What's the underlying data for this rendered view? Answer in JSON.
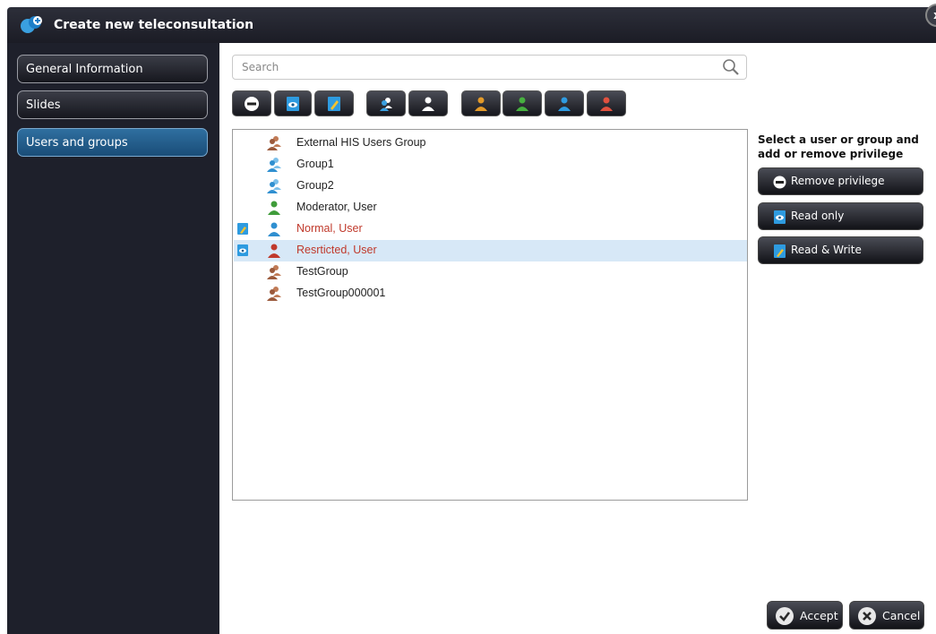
{
  "window": {
    "title": "Create new teleconsultation",
    "close_label": "x"
  },
  "sidebar": {
    "items": [
      {
        "label": "General Information",
        "active": false
      },
      {
        "label": "Slides",
        "active": false
      },
      {
        "label": "Users and groups",
        "active": true
      }
    ]
  },
  "search": {
    "placeholder": "Search",
    "value": ""
  },
  "toolbar": {
    "buttons": [
      {
        "icon": "remove-privilege-icon"
      },
      {
        "icon": "read-only-icon"
      },
      {
        "icon": "read-write-icon"
      },
      {
        "icon": "group-filter-icon"
      },
      {
        "icon": "user-filter-icon"
      },
      {
        "icon": "orange-user-icon",
        "color": "#e39a2a"
      },
      {
        "icon": "green-user-icon",
        "color": "#3f9c3a"
      },
      {
        "icon": "blue-user-icon",
        "color": "#2f8fd0"
      },
      {
        "icon": "red-user-icon",
        "color": "#d9463a"
      }
    ]
  },
  "list": {
    "items": [
      {
        "label": "External HIS Users Group",
        "icon": "group-icon",
        "color": "#9b5a3c",
        "privilege": null,
        "selected": false,
        "highlight": false
      },
      {
        "label": "Group1",
        "icon": "group-icon",
        "color": "#2f8fd0",
        "privilege": null,
        "selected": false,
        "highlight": false
      },
      {
        "label": "Group2",
        "icon": "group-icon",
        "color": "#2f8fd0",
        "privilege": null,
        "selected": false,
        "highlight": false
      },
      {
        "label": "Moderator, User",
        "icon": "user-icon",
        "color": "#3f9c3a",
        "privilege": null,
        "selected": false,
        "highlight": false
      },
      {
        "label": "Normal, User",
        "icon": "user-icon",
        "color": "#2f8fd0",
        "privilege": "read-write",
        "selected": false,
        "highlight": true
      },
      {
        "label": "Resrticted, User",
        "icon": "user-icon",
        "color": "#c0392b",
        "privilege": "read-only",
        "selected": true,
        "highlight": true
      },
      {
        "label": "TestGroup",
        "icon": "group-icon",
        "color": "#9b5a3c",
        "privilege": null,
        "selected": false,
        "highlight": false
      },
      {
        "label": "TestGroup000001",
        "icon": "group-icon",
        "color": "#9b5a3c",
        "privilege": null,
        "selected": false,
        "highlight": false
      }
    ]
  },
  "right_panel": {
    "hint": "Select a user or group and add or remove privilege",
    "buttons": [
      {
        "label": "Remove privilege",
        "icon": "remove-privilege-icon"
      },
      {
        "label": "Read only",
        "icon": "read-only-icon"
      },
      {
        "label": "Read & Write",
        "icon": "read-write-icon"
      }
    ]
  },
  "footer": {
    "accept_label": "Accept",
    "cancel_label": "Cancel"
  },
  "colors": {
    "sidebar_bg": "#1e202b",
    "active_item": "#2f6fa0",
    "selected_row": "#d7e8f7"
  }
}
